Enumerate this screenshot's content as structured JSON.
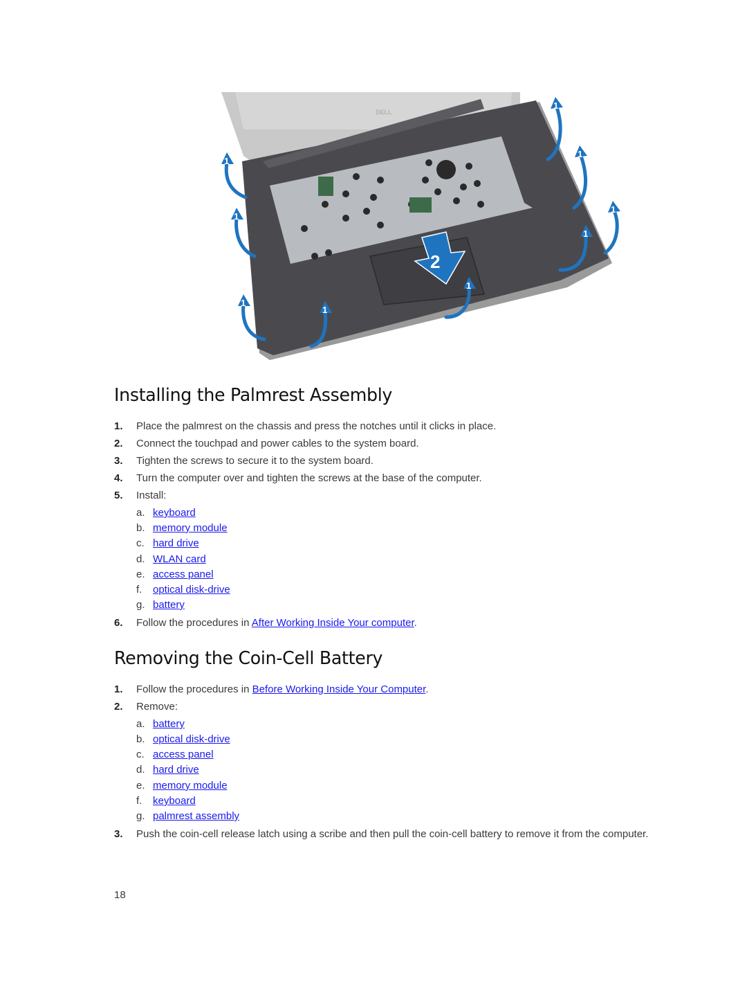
{
  "figure": {
    "description": "Laptop palmrest assembly being installed; blue arrows labeled 1 around edges, large arrow labeled 2 pressing down on palmrest",
    "brand_text": "DELL",
    "callout_labels": [
      "1",
      "2"
    ],
    "arrow_color": "#1f74c0"
  },
  "installing": {
    "title": "Installing the Palmrest Assembly",
    "steps": [
      {
        "num": "1.",
        "text": "Place the palmrest on the chassis and press the notches until it clicks in place."
      },
      {
        "num": "2.",
        "text": "Connect the touchpad and power cables to the system board."
      },
      {
        "num": "3.",
        "text": "Tighten the screws to secure it to the system board."
      },
      {
        "num": "4.",
        "text": "Turn the computer over and tighten the screws at the base of the computer."
      },
      {
        "num": "5.",
        "text": "Install:"
      },
      {
        "num": "6.",
        "text_before": "Follow the procedures in ",
        "link": "After Working Inside Your computer",
        "text_after": "."
      }
    ],
    "install_items": [
      {
        "letter": "a.",
        "label": "keyboard"
      },
      {
        "letter": "b.",
        "label": "memory module"
      },
      {
        "letter": "c.",
        "label": "hard drive"
      },
      {
        "letter": "d.",
        "label": "WLAN card"
      },
      {
        "letter": "e.",
        "label": "access panel"
      },
      {
        "letter": "f.",
        "label": "optical disk-drive"
      },
      {
        "letter": "g.",
        "label": "battery"
      }
    ]
  },
  "removing": {
    "title": "Removing the Coin-Cell Battery",
    "steps": [
      {
        "num": "1.",
        "text_before": "Follow the procedures in ",
        "link": "Before Working Inside Your Computer",
        "text_after": "."
      },
      {
        "num": "2.",
        "text": "Remove:"
      },
      {
        "num": "3.",
        "text": "Push the coin-cell release latch using a scribe and then pull the coin-cell battery to remove it from the computer."
      }
    ],
    "remove_items": [
      {
        "letter": "a.",
        "label": "battery"
      },
      {
        "letter": "b.",
        "label": "optical disk-drive"
      },
      {
        "letter": "c.",
        "label": "access panel"
      },
      {
        "letter": "d.",
        "label": "hard drive"
      },
      {
        "letter": "e.",
        "label": "memory module"
      },
      {
        "letter": "f.",
        "label": "keyboard"
      },
      {
        "letter": "g.",
        "label": "palmrest assembly"
      }
    ]
  },
  "page_number": "18",
  "colors": {
    "link": "#1a1aee",
    "heading": "#111111",
    "body": "#3a3a3a"
  }
}
